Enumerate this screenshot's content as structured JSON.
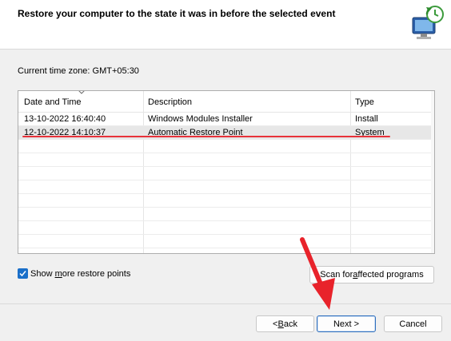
{
  "header": {
    "title": "Restore your computer to the state it was in before the selected event"
  },
  "timezone_label": "Current time zone: GMT+05:30",
  "restore_list": {
    "columns": [
      "Date and Time",
      "Description",
      "Type"
    ],
    "rows": [
      {
        "date": "13-10-2022 16:40:40",
        "description": "Windows Modules Installer",
        "type": "Install",
        "selected": false
      },
      {
        "date": "12-10-2022 14:10:37",
        "description": "Automatic Restore Point",
        "type": "System",
        "selected": true
      }
    ]
  },
  "show_more": {
    "label_pre": "Show ",
    "label_accel": "m",
    "label_post": "ore restore points",
    "checked": true
  },
  "scan_button": {
    "pre": "Scan for ",
    "accel": "a",
    "post": "ffected programs"
  },
  "buttons": {
    "back": {
      "pre": "< ",
      "accel": "B",
      "post": "ack"
    },
    "next": "Next >",
    "cancel": "Cancel"
  },
  "colors": {
    "accent": "#1a6fc9",
    "annotation_red": "#e8323a",
    "selected_row": "#e7e7e7"
  },
  "icons": [
    "system-restore-icon",
    "sort-chevron-icon",
    "checkmark-icon",
    "annotation-arrow-icon"
  ]
}
